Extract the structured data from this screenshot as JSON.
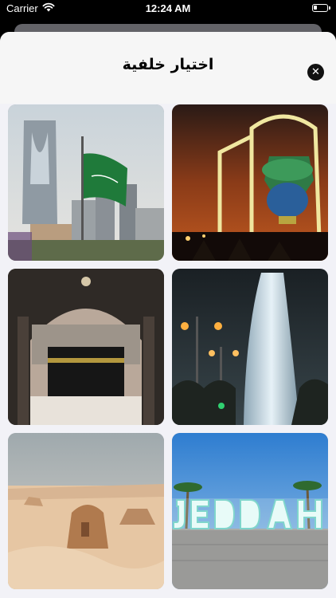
{
  "status_bar": {
    "carrier": "Carrier",
    "time": "12:24 AM"
  },
  "sheet": {
    "title": "اختيار خلفية"
  },
  "icons": {
    "close": "close-icon",
    "wifi": "wifi-icon",
    "battery": "battery-icon"
  },
  "backgrounds": [
    {
      "name": "riyadh-kingdom-tower-flag"
    },
    {
      "name": "ramadan-lantern-night"
    },
    {
      "name": "kaaba-mecca"
    },
    {
      "name": "jeddah-fountain-night"
    },
    {
      "name": "alula-desert-tomb"
    },
    {
      "name": "jeddah-sign"
    }
  ]
}
